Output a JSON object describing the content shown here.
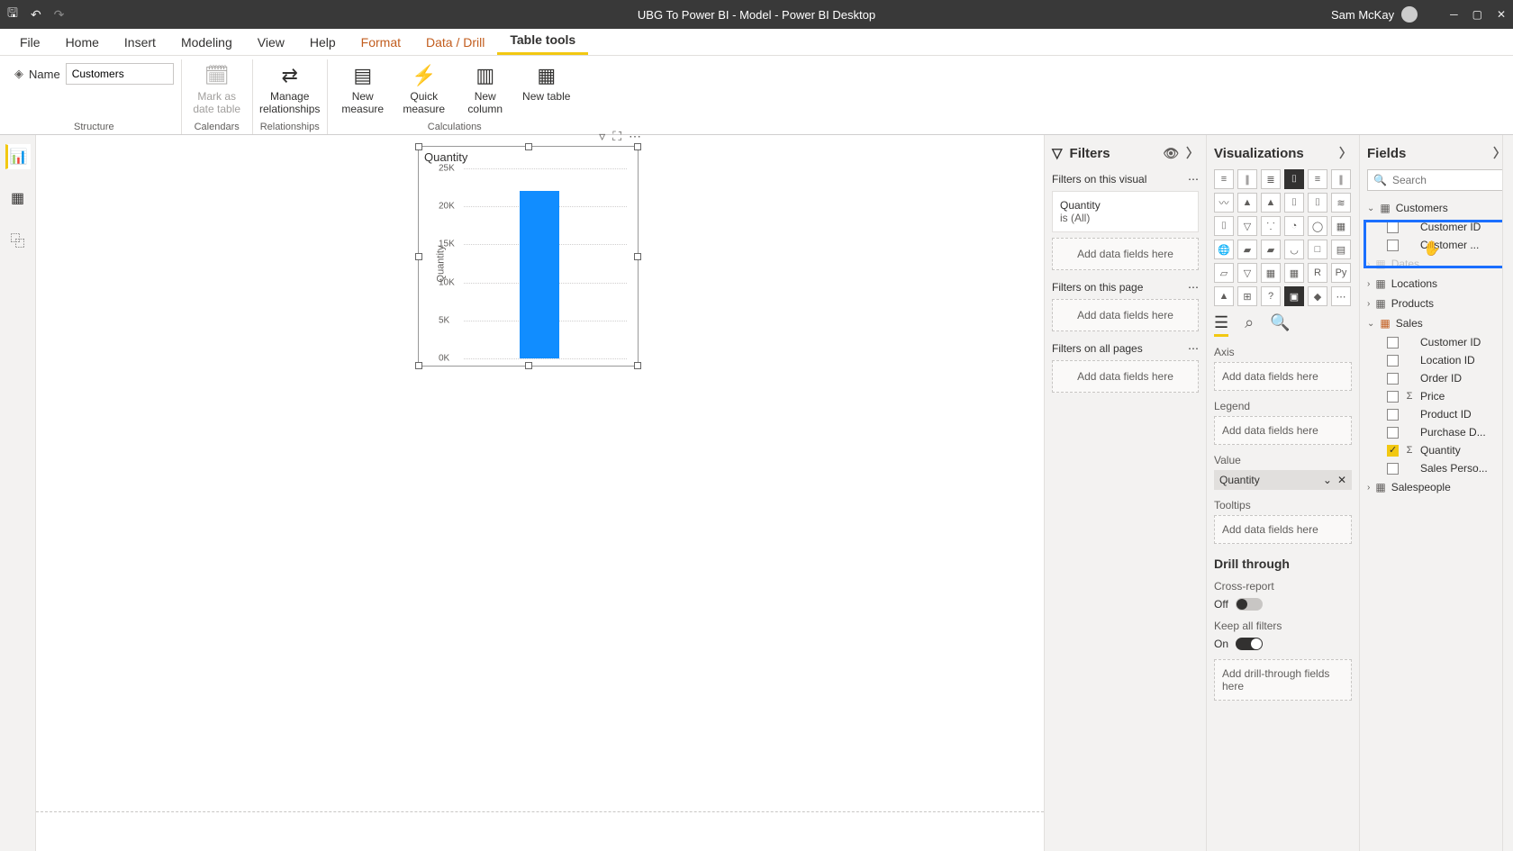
{
  "titlebar": {
    "title": "UBG To Power BI - Model - Power BI Desktop",
    "username": "Sam McKay"
  },
  "tabs": {
    "file": "File",
    "home": "Home",
    "insert": "Insert",
    "modeling": "Modeling",
    "view": "View",
    "help": "Help",
    "format": "Format",
    "datadrill": "Data / Drill",
    "tabletools": "Table tools"
  },
  "ribbon": {
    "name_label": "Name",
    "name_value": "Customers",
    "mark_as_date": "Mark as date table",
    "manage_rel": "Manage relationships",
    "new_measure": "New measure",
    "quick_measure": "Quick measure",
    "new_column": "New column",
    "new_table": "New table",
    "grp_structure": "Structure",
    "grp_calendars": "Calendars",
    "grp_relationships": "Relationships",
    "grp_calculations": "Calculations"
  },
  "chart_data": {
    "type": "bar",
    "title": "Quantity",
    "ylabel": "Quantity",
    "categories": [
      ""
    ],
    "values": [
      22000
    ],
    "ylim": [
      0,
      25000
    ],
    "yticks": [
      "0K",
      "5K",
      "10K",
      "15K",
      "20K",
      "25K"
    ]
  },
  "filters": {
    "title": "Filters",
    "on_visual": "Filters on this visual",
    "card_title": "Quantity",
    "card_sub": "is (All)",
    "on_page": "Filters on this page",
    "on_all": "Filters on all pages",
    "add_here": "Add data fields here"
  },
  "viz": {
    "title": "Visualizations",
    "axis": "Axis",
    "legend": "Legend",
    "value": "Value",
    "value_pill": "Quantity",
    "tooltips": "Tooltips",
    "add_here": "Add data fields here",
    "drill": "Drill through",
    "cross": "Cross-report",
    "off": "Off",
    "keep": "Keep all filters",
    "on": "On",
    "add_drill": "Add drill-through fields here"
  },
  "fields": {
    "title": "Fields",
    "search_ph": "Search",
    "tables": {
      "customers": "Customers",
      "locations": "Locations",
      "products": "Products",
      "sales": "Sales",
      "salespeople": "Salespeople"
    },
    "customers_fields": {
      "customer_id": "Customer ID",
      "customer_name": "Customer ..."
    },
    "hidden_table": "Dates",
    "sales_fields": {
      "customer_id": "Customer ID",
      "location_id": "Location ID",
      "order_id": "Order ID",
      "price": "Price",
      "product_id": "Product ID",
      "purchase_d": "Purchase D...",
      "quantity": "Quantity",
      "sales_perso": "Sales Perso..."
    }
  }
}
